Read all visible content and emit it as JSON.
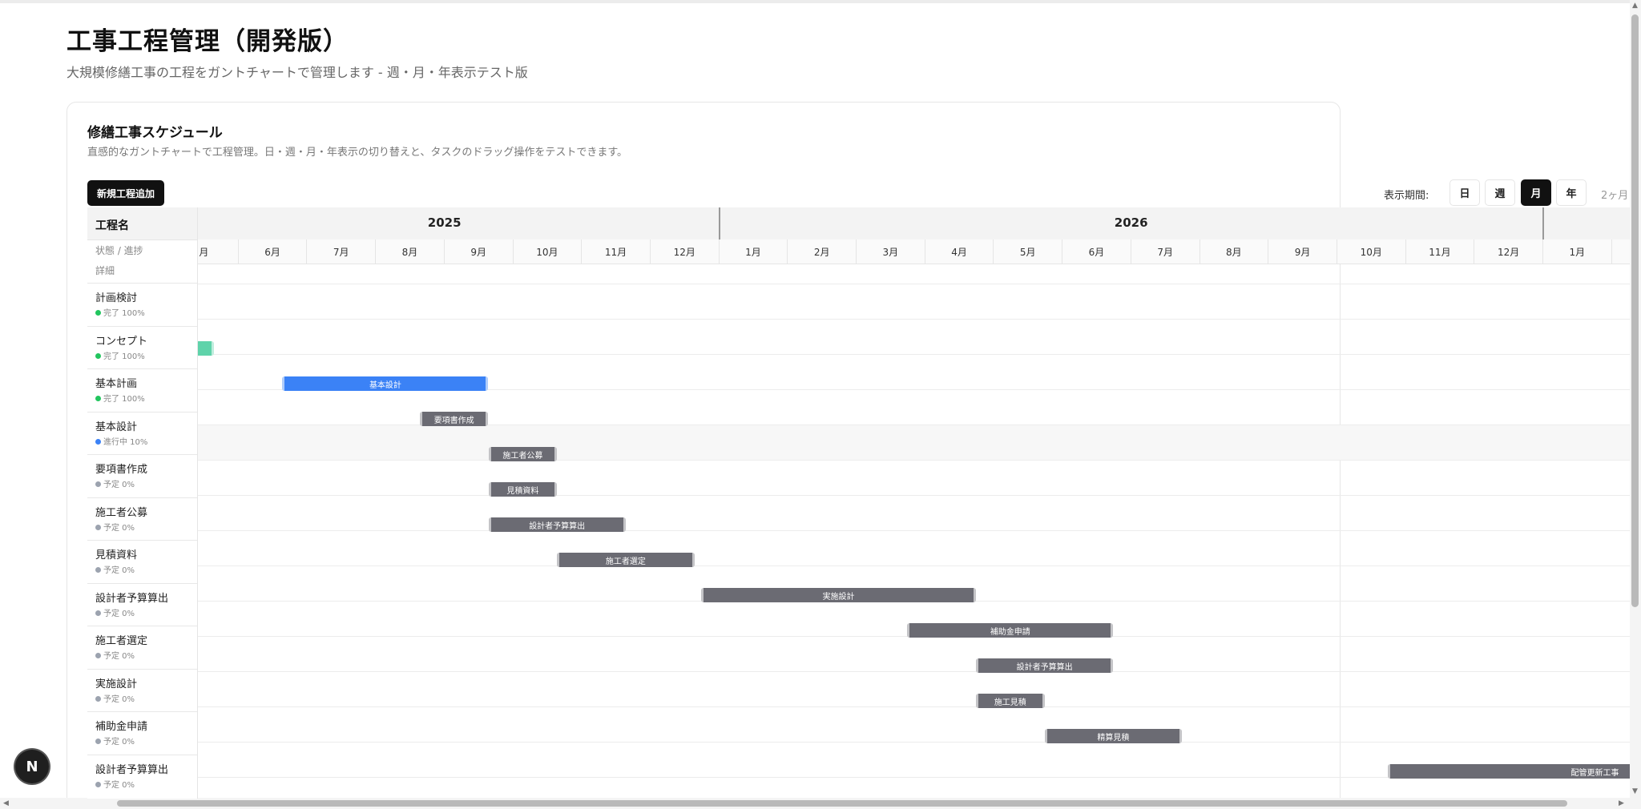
{
  "header": {
    "title": "工事工程管理（開発版）",
    "subtitle": "大規模修繕工事の工程をガントチャートで管理します - 週・月・年表示テスト版"
  },
  "card": {
    "title": "修繕工事スケジュール",
    "description": "直感的なガントチャートで工程管理。日・週・月・年表示の切り替えと、タスクのドラッグ操作をテストできます。",
    "add_button": "新規工程追加"
  },
  "period": {
    "label": "表示期間:",
    "options": [
      "日",
      "週",
      "月",
      "年"
    ],
    "active": "月",
    "more": "2ヶ月"
  },
  "gantt": {
    "header_name": "工程名",
    "header_status": "状態 / 進捗",
    "header_detail": "詳細",
    "years": [
      {
        "label": "2025",
        "start_index": 0,
        "span": 8
      },
      {
        "label": "2026",
        "start_index": 8,
        "span": 12
      },
      {
        "label": "",
        "start_index": 20,
        "span": 2
      }
    ],
    "months": [
      "月",
      "6月",
      "7月",
      "8月",
      "9月",
      "10月",
      "11月",
      "12月",
      "1月",
      "2月",
      "3月",
      "4月",
      "5月",
      "6月",
      "7月",
      "8月",
      "9月",
      "10月",
      "11月",
      "12月",
      "1月",
      ""
    ],
    "tasks": [
      {
        "name": "計画検討",
        "status": "完了 100%",
        "status_color": "#22c55e"
      },
      {
        "name": "コンセプト",
        "status": "完了 100%",
        "status_color": "#22c55e"
      },
      {
        "name": "基本計画",
        "status": "完了 100%",
        "status_color": "#22c55e"
      },
      {
        "name": "基本設計",
        "status": "進行中 10%",
        "status_color": "#3b82f6"
      },
      {
        "name": "要項書作成",
        "status": "予定 0%",
        "status_color": "#9ca3af"
      },
      {
        "name": "施工者公募",
        "status": "予定 0%",
        "status_color": "#9ca3af"
      },
      {
        "name": "見積資料",
        "status": "予定 0%",
        "status_color": "#9ca3af"
      },
      {
        "name": "設計者予算算出",
        "status": "予定 0%",
        "status_color": "#9ca3af"
      },
      {
        "name": "施工者選定",
        "status": "予定 0%",
        "status_color": "#9ca3af"
      },
      {
        "name": "実施設計",
        "status": "予定 0%",
        "status_color": "#9ca3af"
      },
      {
        "name": "補助金申請",
        "status": "予定 0%",
        "status_color": "#9ca3af"
      },
      {
        "name": "設計者予算算出",
        "status": "予定 0%",
        "status_color": "#9ca3af"
      }
    ],
    "bars": [
      {
        "label": "",
        "start": -0.4,
        "end": 0.65,
        "color": "#5fd3aa"
      },
      {
        "label": "基本設計",
        "start": 1.65,
        "end": 4.65,
        "color": "#3b82f6"
      },
      {
        "label": "要項書作成",
        "start": 3.65,
        "end": 4.65,
        "color": "#6b6b73"
      },
      {
        "label": "施工者公募",
        "start": 4.65,
        "end": 5.65,
        "color": "#6b6b73"
      },
      {
        "label": "見積資料",
        "start": 4.65,
        "end": 5.65,
        "color": "#6b6b73"
      },
      {
        "label": "設計者予算算出",
        "start": 4.65,
        "end": 6.65,
        "color": "#6b6b73"
      },
      {
        "label": "施工者選定",
        "start": 5.65,
        "end": 7.65,
        "color": "#6b6b73"
      },
      {
        "label": "実施設計",
        "start": 7.75,
        "end": 11.75,
        "color": "#6b6b73"
      },
      {
        "label": "補助金申請",
        "start": 10.75,
        "end": 13.75,
        "color": "#6b6b73"
      },
      {
        "label": "設計者予算算出",
        "start": 11.75,
        "end": 13.75,
        "color": "#6b6b73"
      },
      {
        "label": "施工見積",
        "start": 11.75,
        "end": 12.75,
        "color": "#6b6b73"
      },
      {
        "label": "精算見積",
        "start": 12.75,
        "end": 14.75,
        "color": "#6b6b73"
      },
      {
        "label": "配管更新工事",
        "start": 17.75,
        "end": 21.5,
        "color": "#6b6b73"
      }
    ]
  },
  "badge": {
    "label": "N"
  }
}
